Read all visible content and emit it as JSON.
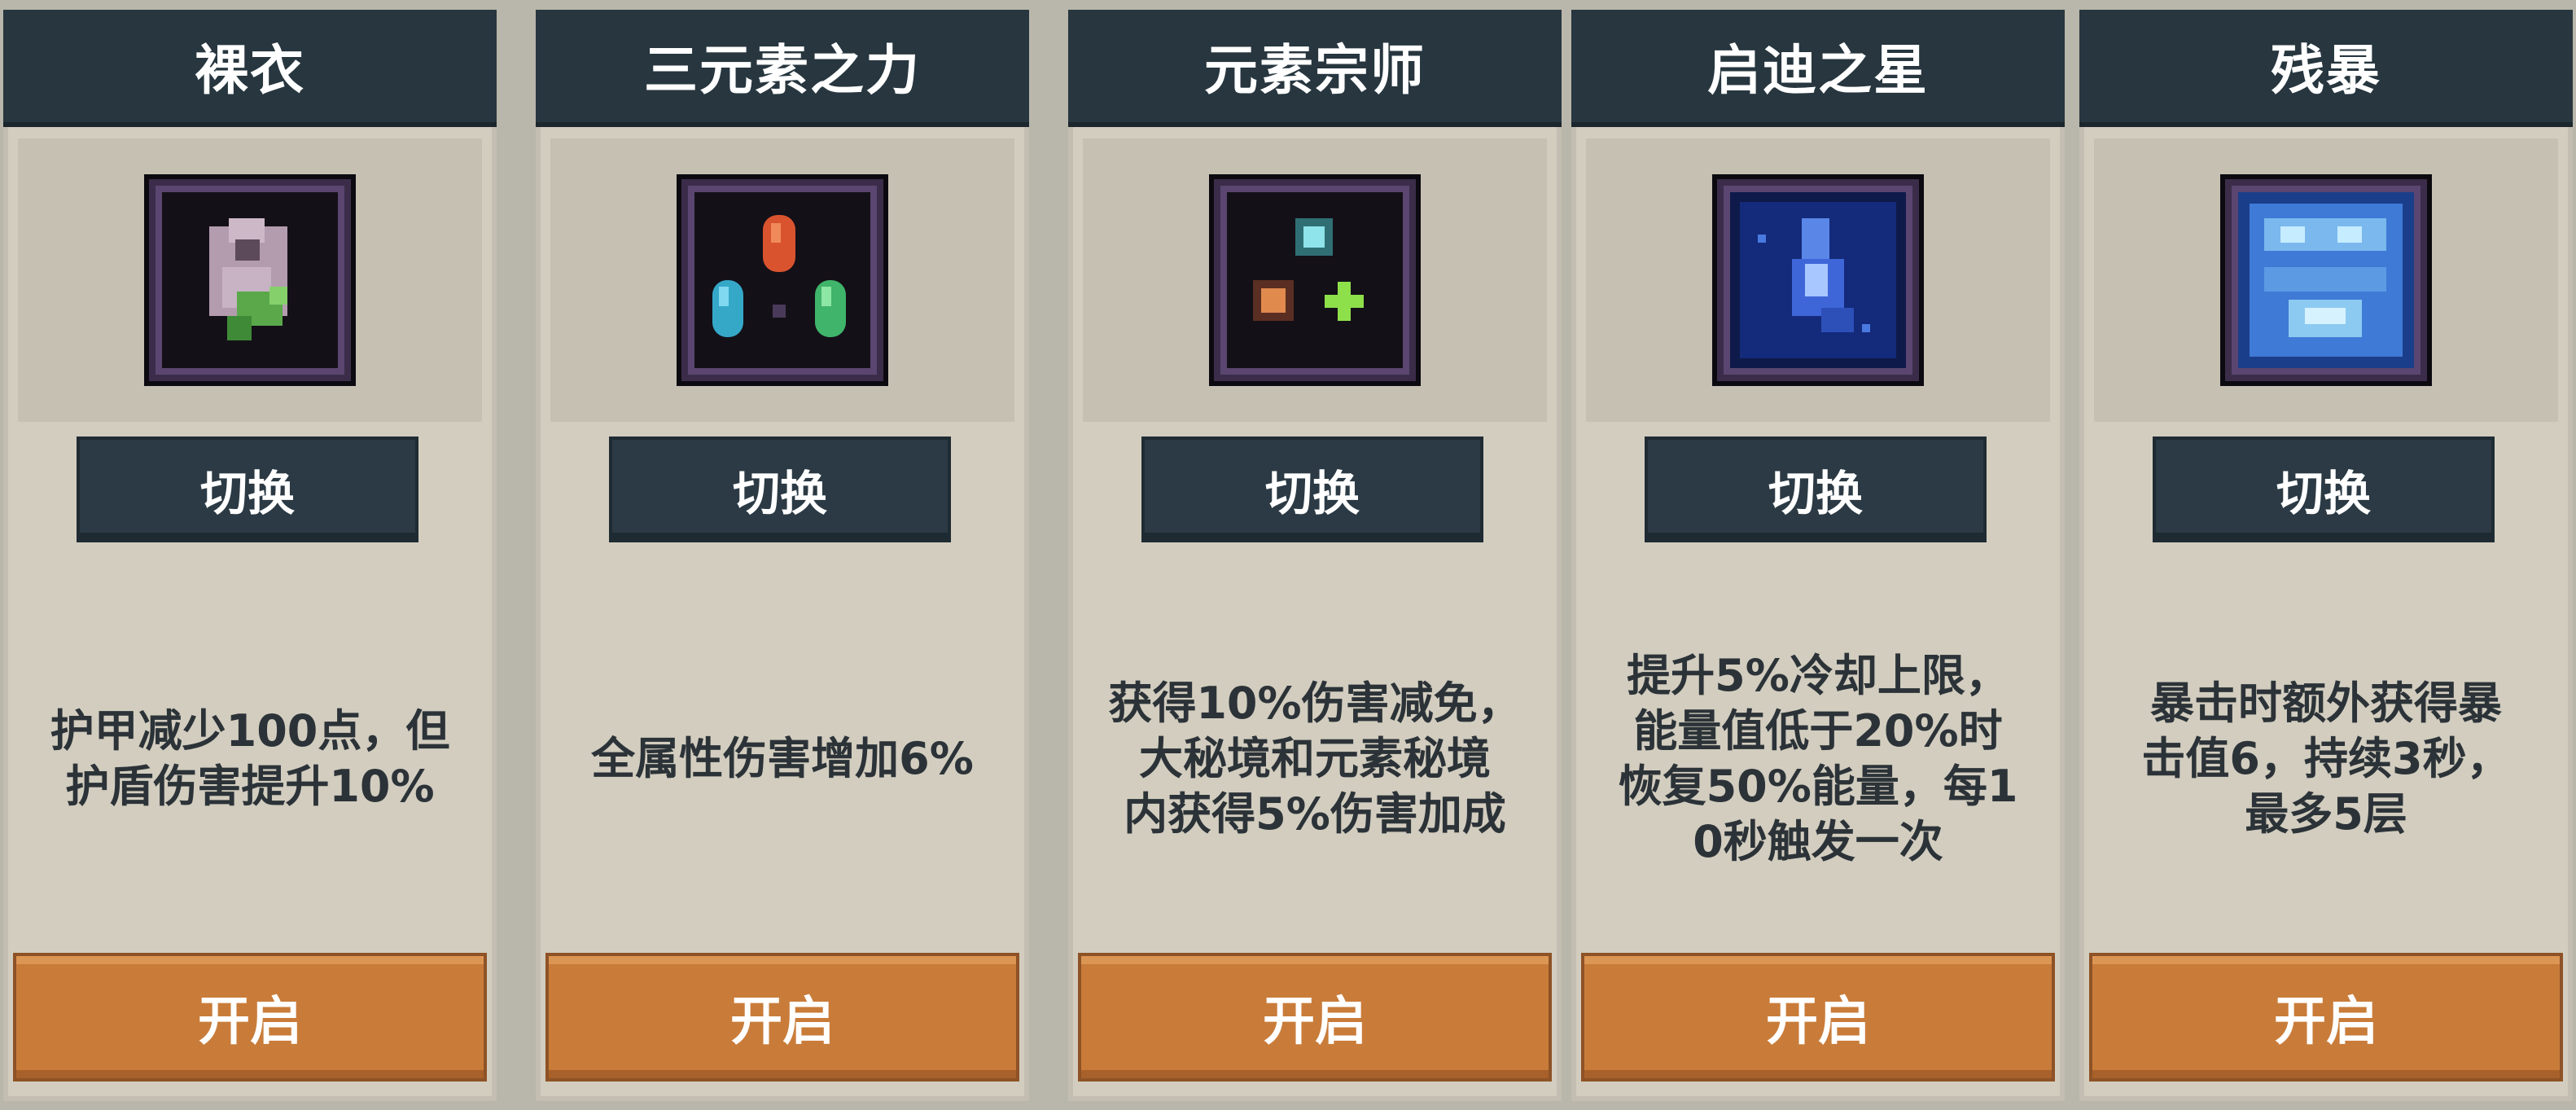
{
  "cards": [
    {
      "title": "裸衣",
      "icon": "naked-robe-icon",
      "switch_label": "切换",
      "description": "护甲减少100点，但\n护盾伤害提升10%",
      "open_label": "开启"
    },
    {
      "title": "三元素之力",
      "icon": "three-element-crystals-icon",
      "switch_label": "切换",
      "description": "全属性伤害增加6%",
      "open_label": "开启"
    },
    {
      "title": "元素宗师",
      "icon": "element-master-icon",
      "switch_label": "切换",
      "description": "获得10%伤害减免，\n大秘境和元素秘境\n内获得5%伤害加成",
      "open_label": "开启"
    },
    {
      "title": "启迪之星",
      "icon": "enlightenment-star-icon",
      "switch_label": "切换",
      "description": "提升5%冷却上限，\n能量值低于20%时\n恢复50%能量，每1\n0秒触发一次",
      "open_label": "开启"
    },
    {
      "title": "残暴",
      "icon": "brutality-icon",
      "switch_label": "切换",
      "description": "暴击时额外获得暴\n击值6，持续3秒，\n最多5层",
      "open_label": "开启"
    }
  ],
  "colors": {
    "title_bar": "#27363f",
    "switch_button": "#2b3a44",
    "open_button": "#c97c3a",
    "card_bg": "#d2cdbf"
  }
}
